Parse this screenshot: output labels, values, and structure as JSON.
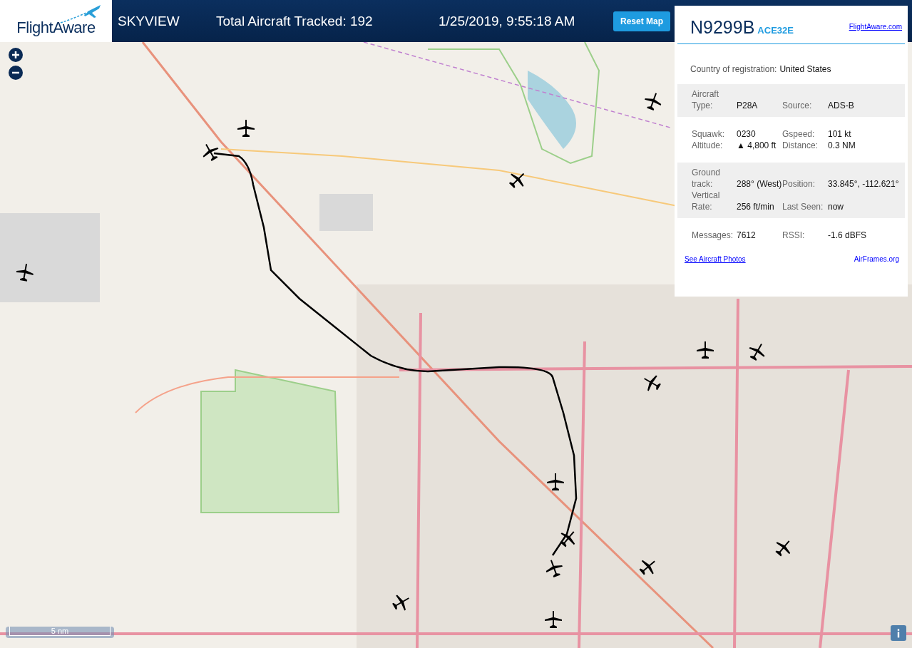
{
  "header": {
    "logo": "FlightAware",
    "title": "SKYVIEW",
    "tracked": "Total Aircraft Tracked: 192",
    "datetime": "1/25/2019, 9:55:18 AM",
    "reset_button": "Reset Map"
  },
  "panel": {
    "registration": "N9299B",
    "hex": "ACE32E",
    "site_link": "FlightAware.com",
    "country_label": "Country of registration:",
    "country_value": "United States",
    "sections": [
      {
        "shaded": true,
        "rows": [
          [
            {
              "label": "Aircraft Type:",
              "value": "P28A"
            },
            {
              "label": "Source:",
              "value": "ADS-B"
            }
          ]
        ]
      },
      {
        "shaded": false,
        "rows": [
          [
            {
              "label": "Squawk:",
              "value": "0230"
            },
            {
              "label": "Gspeed:",
              "value": "101 kt"
            }
          ],
          [
            {
              "label": "Altitude:",
              "value": "▲ 4,800 ft"
            },
            {
              "label": "Distance:",
              "value": "0.3 NM"
            }
          ]
        ]
      },
      {
        "shaded": true,
        "rows": [
          [
            {
              "label": "Ground track:",
              "value": "288° (West)"
            },
            {
              "label": "Position:",
              "value": "33.845°, -112.621°"
            }
          ],
          [
            {
              "label": "Vertical Rate:",
              "value": "256 ft/min"
            },
            {
              "label": "Last Seen:",
              "value": "now"
            }
          ]
        ]
      },
      {
        "shaded": false,
        "rows": [
          [
            {
              "label": "Messages:",
              "value": "7612"
            },
            {
              "label": "RSSI:",
              "value": "-1.6 dBFS"
            }
          ]
        ]
      }
    ],
    "photos_link": "See Aircraft Photos",
    "airframes_link": "AirFrames.org"
  },
  "map": {
    "scale": "5 nm"
  }
}
